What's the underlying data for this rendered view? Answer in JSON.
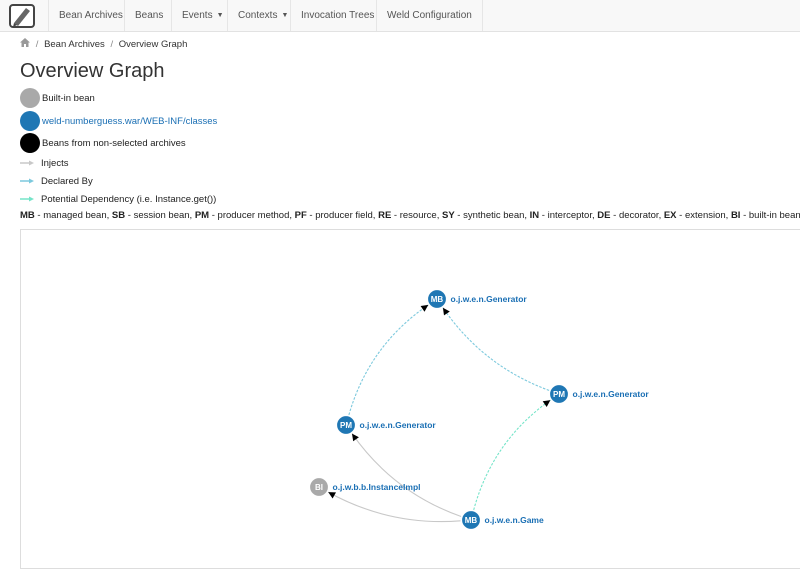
{
  "colors": {
    "builtin": "#a9a9a9",
    "archive": "#1f77b4",
    "non_selected": "#000000",
    "injects": "#c8c8c8",
    "declared_by": "#7cc9dd",
    "potential_dependency": "#75e4c9",
    "link_text": "#1a6fb4"
  },
  "navbar": {
    "brand_icon": "notebook-icon",
    "items": [
      {
        "label": "Bean Archives",
        "dropdown": false
      },
      {
        "label": "Beans",
        "dropdown": false
      },
      {
        "label": "Events",
        "dropdown": true
      },
      {
        "label": "Contexts",
        "dropdown": true
      },
      {
        "label": "Invocation Trees",
        "dropdown": false
      },
      {
        "label": "Weld Configuration",
        "dropdown": false
      }
    ]
  },
  "breadcrumb": {
    "home_icon": "home-icon",
    "items": [
      "Bean Archives",
      "Overview Graph"
    ]
  },
  "page_title": "Overview Graph",
  "legend": {
    "nodes": [
      {
        "label": "Built-in bean",
        "kind": "builtin"
      },
      {
        "label": "weld-numberguess.war/WEB-INF/classes",
        "kind": "archive"
      },
      {
        "label": "Beans from non-selected archives",
        "kind": "non_selected"
      }
    ],
    "edges": [
      {
        "label": "Injects",
        "kind": "injects"
      },
      {
        "label": "Declared By",
        "kind": "declared_by"
      },
      {
        "label": "Potential Dependency (i.e. Instance.get())",
        "kind": "potential_dependency"
      }
    ]
  },
  "abbreviations": [
    {
      "abbr": "MB",
      "text": "managed bean"
    },
    {
      "abbr": "SB",
      "text": "session bean"
    },
    {
      "abbr": "PM",
      "text": "producer method"
    },
    {
      "abbr": "PF",
      "text": "producer field"
    },
    {
      "abbr": "RE",
      "text": "resource"
    },
    {
      "abbr": "SY",
      "text": "synthetic bean"
    },
    {
      "abbr": "IN",
      "text": "interceptor"
    },
    {
      "abbr": "DE",
      "text": "decorator"
    },
    {
      "abbr": "EX",
      "text": "extension"
    },
    {
      "abbr": "BI",
      "text": "built-in bean"
    }
  ],
  "graph": {
    "nodes": [
      {
        "id": "gen_mb",
        "abbr": "MB",
        "label": "o.j.w.e.n.Generator",
        "kind": "archive"
      },
      {
        "id": "gen_pm_right",
        "abbr": "PM",
        "label": "o.j.w.e.n.Generator",
        "kind": "archive"
      },
      {
        "id": "gen_pm_left",
        "abbr": "PM",
        "label": "o.j.w.e.n.Generator",
        "kind": "archive"
      },
      {
        "id": "instance",
        "abbr": "BI",
        "label": "o.j.w.b.b.InstanceImpl",
        "kind": "builtin"
      },
      {
        "id": "game",
        "abbr": "MB",
        "label": "o.j.w.e.n.Game",
        "kind": "archive"
      }
    ],
    "edges": [
      {
        "from": "gen_pm_left",
        "to": "gen_mb",
        "kind": "declared_by"
      },
      {
        "from": "gen_pm_right",
        "to": "gen_mb",
        "kind": "declared_by"
      },
      {
        "from": "game",
        "to": "gen_pm_right",
        "kind": "potential_dependency"
      },
      {
        "from": "game",
        "to": "gen_pm_left",
        "kind": "injects"
      },
      {
        "from": "game",
        "to": "instance",
        "kind": "injects"
      }
    ]
  }
}
